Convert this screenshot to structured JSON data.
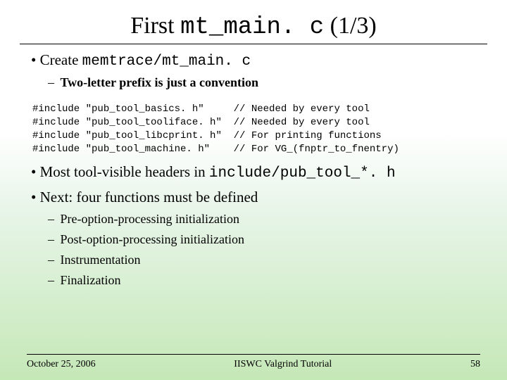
{
  "title": {
    "prefix": "First ",
    "code": "mt_main. c",
    "suffix": " (1/3)"
  },
  "bullets": {
    "b1_prefix": "Create ",
    "b1_code": "memtrace/mt_main. c",
    "b1_sub1": "Two-letter prefix is just a convention",
    "code": "#include \"pub_tool_basics. h\"     // Needed by every tool\n#include \"pub_tool_tooliface. h\"  // Needed by every tool\n#include \"pub_tool_libcprint. h\"  // For printing functions\n#include \"pub_tool_machine. h\"    // For VG_(fnptr_to_fnentry)",
    "b2_prefix": "Most tool-visible headers in ",
    "b2_code": "include/pub_tool_*. h",
    "b3": "Next: four functions must be defined",
    "b3_sub1": "Pre-option-processing initialization",
    "b3_sub2": "Post-option-processing initialization",
    "b3_sub3": "Instrumentation",
    "b3_sub4": "Finalization"
  },
  "footer": {
    "date": "October 25, 2006",
    "center": "IISWC Valgrind Tutorial",
    "page": "58"
  }
}
